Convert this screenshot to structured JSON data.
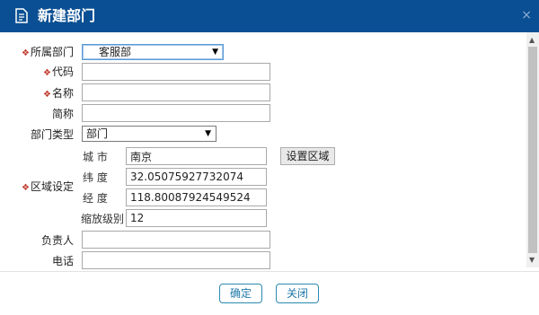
{
  "dialog": {
    "title": "新建部门",
    "close_symbol": "×",
    "title_icon": "document-icon"
  },
  "form": {
    "required_mark": "❖",
    "parent_dept": {
      "label": "所属部门",
      "value": "客服部"
    },
    "code": {
      "label": "代码",
      "value": ""
    },
    "name": {
      "label": "名称",
      "value": ""
    },
    "short_name": {
      "label": "简称",
      "value": ""
    },
    "dept_type": {
      "label": "部门类型",
      "value": "部门"
    },
    "region": {
      "label": "区域设定",
      "city_label": "城 市",
      "city_value": "南京",
      "lat_label": "纬 度",
      "lat_value": "32.05075927732074",
      "lng_label": "经 度",
      "lng_value": "118.80087924549524",
      "zoom_label": "缩放级别",
      "zoom_value": "12",
      "set_button": "设置区域"
    },
    "manager": {
      "label": "负责人",
      "value": ""
    },
    "phone": {
      "label": "电话",
      "value": ""
    }
  },
  "footer": {
    "confirm": "确定",
    "close": "关闭"
  },
  "colors": {
    "title_bar": "#0a4f93",
    "required_mark": "#c0392b",
    "footer_button": "#1f79a8"
  }
}
